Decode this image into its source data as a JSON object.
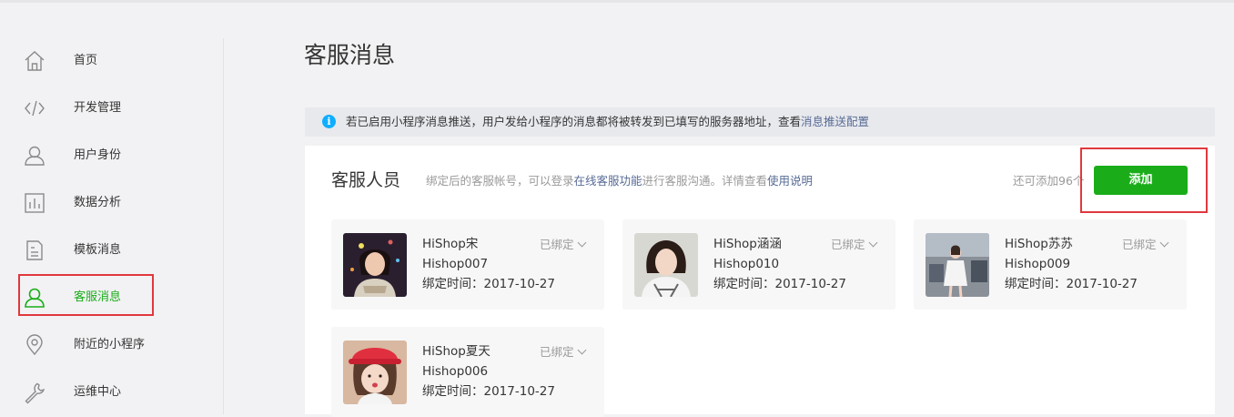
{
  "sidebar": {
    "items": [
      {
        "label": "首页",
        "icon": "home-icon"
      },
      {
        "label": "开发管理",
        "icon": "code-icon"
      },
      {
        "label": "用户身份",
        "icon": "user-icon"
      },
      {
        "label": "数据分析",
        "icon": "chart-icon"
      },
      {
        "label": "模板消息",
        "icon": "document-icon"
      },
      {
        "label": "客服消息",
        "icon": "customer-service-icon"
      },
      {
        "label": "附近的小程序",
        "icon": "location-pin-icon"
      },
      {
        "label": "运维中心",
        "icon": "wrench-icon"
      }
    ],
    "active_index": 5
  },
  "page": {
    "title": "客服消息"
  },
  "notice": {
    "text": "若已启用小程序消息推送，用户发给小程序的消息都将被转发到已填写的服务器地址，查看",
    "link": "消息推送配置"
  },
  "panel": {
    "title": "客服人员",
    "desc_before": "绑定后的客服帐号，可以登录",
    "desc_link1": "在线客服功能",
    "desc_middle": "进行客服沟通。详情查看",
    "desc_link2": "使用说明",
    "remain": "还可添加96个",
    "add_label": "添加"
  },
  "cards": [
    {
      "name": "HiShop宋",
      "account": "Hishop007",
      "time": "绑定时间：2017-10-27",
      "status": "已绑定"
    },
    {
      "name": "HiShop涵涵",
      "account": "Hishop010",
      "time": "绑定时间：2017-10-27",
      "status": "已绑定"
    },
    {
      "name": "HiShop苏苏",
      "account": "Hishop009",
      "time": "绑定时间：2017-10-27",
      "status": "已绑定"
    },
    {
      "name": "HiShop夏天",
      "account": "Hishop006",
      "time": "绑定时间：2017-10-27",
      "status": "已绑定"
    }
  ],
  "colors": {
    "accent": "#1aad19",
    "link": "#576b95",
    "highlight": "#e0383e",
    "info": "#10aeff"
  }
}
